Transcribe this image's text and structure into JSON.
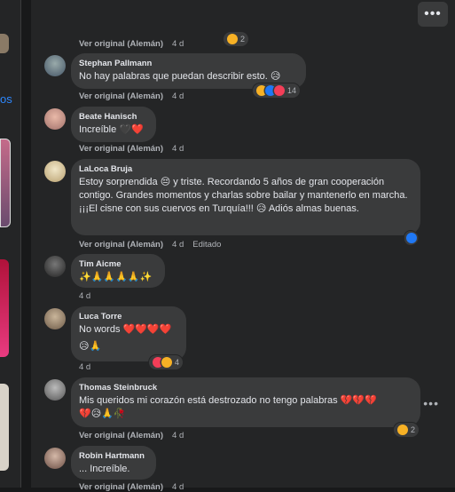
{
  "menu": {
    "more_label": "•••"
  },
  "left": {
    "partial_text": "os"
  },
  "comments": [
    {
      "name": "",
      "text": "",
      "translate": "Ver original (Alemán)",
      "time": "4 d",
      "react_count": "2"
    },
    {
      "name": "Stephan Pallmann",
      "text": "No hay palabras que puedan describir esto. 😥",
      "translate": "Ver original (Alemán)",
      "time": "4 d",
      "react_count": "14"
    },
    {
      "name": "Beate Hanisch",
      "text": "Increíble 🖤❤️",
      "translate": "Ver original (Alemán)",
      "time": "4 d"
    },
    {
      "name": "LaLoca Bruja",
      "text": "Estoy sorprendida 😔 y triste. Recordando 5 años de gran cooperación contigo. Grandes momentos y charlas sobre bailar y mantenerlo en marcha. ¡¡¡El cisne con sus cuervos en Turquía!!! 😥 Adiós almas buenas.",
      "translate": "Ver original (Alemán)",
      "time": "4 d",
      "edited": "Editado"
    },
    {
      "name": "Tim Aicme",
      "text": "✨🙏🙏🙏🙏✨",
      "time": "4 d"
    },
    {
      "name": "Luca Torre",
      "text": "No words ❤️❤️❤️❤️",
      "text2": "😥🙏",
      "time": "4 d",
      "react_count": "4"
    },
    {
      "name": "Thomas Steinbruck",
      "text": "Mis queridos mi corazón está destrozado no tengo palabras 💔💔💔",
      "text2": "💔😥🙏🥀",
      "translate": "Ver original (Alemán)",
      "time": "4 d",
      "react_count": "2"
    },
    {
      "name": "Robin Hartmann",
      "text": "... Increíble.",
      "translate": "Ver original (Alemán)",
      "time": "4 d"
    }
  ]
}
